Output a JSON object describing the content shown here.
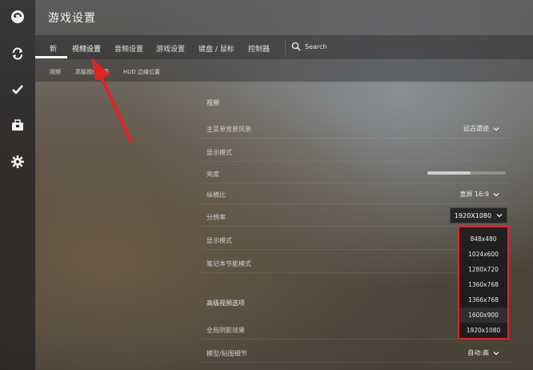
{
  "window": {
    "title": "游戏设置"
  },
  "tabs": [
    {
      "label": "新"
    },
    {
      "label": "视频设置"
    },
    {
      "label": "音频设置"
    },
    {
      "label": "游戏设置"
    },
    {
      "label": "键盘 / 鼠标"
    },
    {
      "label": "控制器"
    }
  ],
  "search": {
    "label": "Search"
  },
  "subtabs": [
    {
      "label": "视频"
    },
    {
      "label": "高级视频选项"
    },
    {
      "label": "HUD 边缘位置"
    }
  ],
  "settings": {
    "section_video": "视频",
    "rows": [
      {
        "label": "主菜单背景风景",
        "value": "远古遗迹"
      },
      {
        "label": "显示模式",
        "value": ""
      },
      {
        "label": "亮度",
        "value": ""
      },
      {
        "label": "纵横比",
        "value": "宽屏 16:9"
      },
      {
        "label": "分辨率",
        "value": "1920X1080"
      },
      {
        "label": "显示模式",
        "value": ""
      },
      {
        "label": "笔记本节能模式",
        "value": ""
      }
    ],
    "brightness_level": 0.55,
    "section_advanced": "高级视频选项",
    "adv_rows": [
      {
        "label": "全局阴影效果",
        "value": ""
      },
      {
        "label": "模型/贴图细节",
        "value": "自动:高"
      }
    ]
  },
  "resolution_dropdown": {
    "options": [
      "848x480",
      "1024x600",
      "1280x720",
      "1360x768",
      "1366x768",
      "1600x900",
      "1920x1080"
    ],
    "hovered_index": 5,
    "highlight_color": "#e02424"
  },
  "annotation_arrow_color": "#e02424",
  "icons": {
    "sidebar": [
      "play-icon",
      "refresh-icon",
      "check-icon",
      "briefcase-icon",
      "gear-icon"
    ],
    "search": "search-icon",
    "chevron": "chevron-down-icon"
  }
}
